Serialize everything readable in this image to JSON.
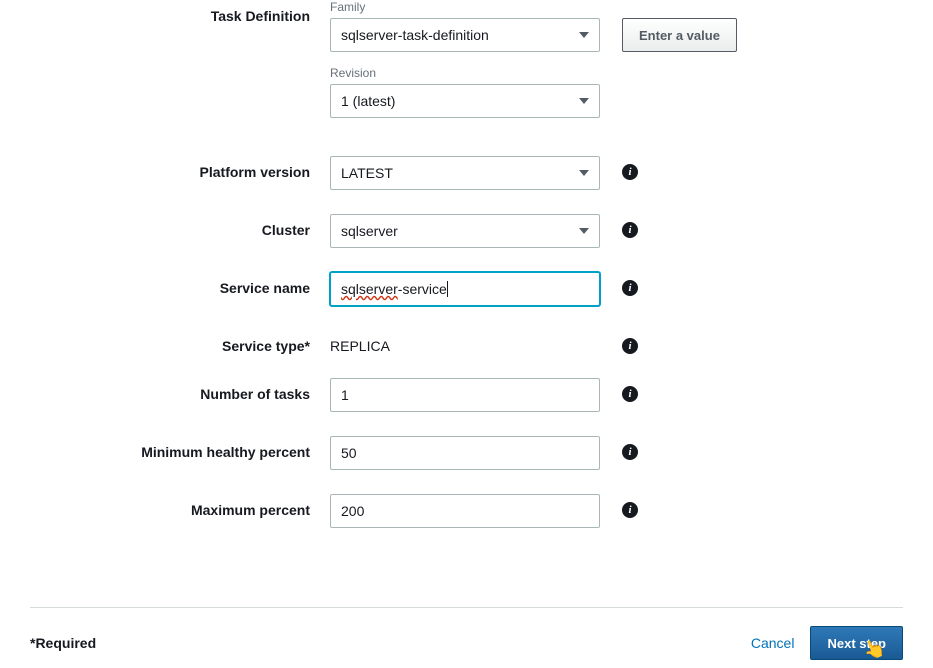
{
  "labels": {
    "task_definition": "Task Definition",
    "family": "Family",
    "revision": "Revision",
    "platform_version": "Platform version",
    "cluster": "Cluster",
    "service_name": "Service name",
    "service_type": "Service type*",
    "number_of_tasks": "Number of tasks",
    "min_healthy_percent": "Minimum healthy percent",
    "max_percent": "Maximum percent"
  },
  "values": {
    "family": "sqlserver-task-definition",
    "revision": "1 (latest)",
    "platform_version": "LATEST",
    "cluster": "sqlserver",
    "service_name_prefix": "sqlserver",
    "service_name_suffix": "-service",
    "service_type": "REPLICA",
    "number_of_tasks": "1",
    "min_healthy_percent": "50",
    "max_percent": "200"
  },
  "buttons": {
    "enter_value": "Enter a value",
    "cancel": "Cancel",
    "next_step": "Next step"
  },
  "footer": {
    "required": "*Required"
  }
}
